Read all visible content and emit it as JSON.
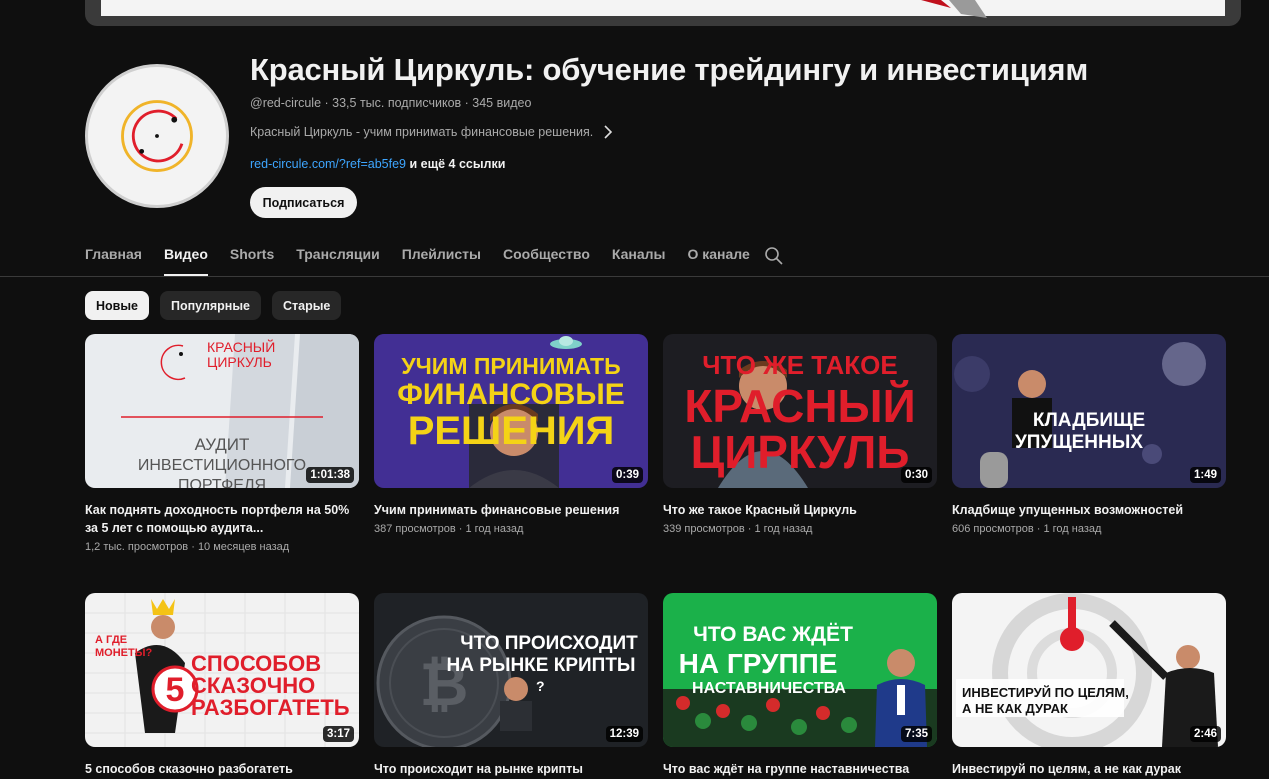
{
  "channel": {
    "title": "Красный Циркуль: обучение трейдингу и инвестициям",
    "handle": "@red-circule",
    "subscribers": "33,5 тыс. подписчиков",
    "video_count": "345 видео",
    "meta_separator": " · ",
    "description": "Красный Циркуль - учим принимать финансовые решения.",
    "link": "red-circule.com/?ref=ab5fe9",
    "more_links": " и ещё 4 ссылки",
    "subscribe_label": "Подписаться",
    "avatar_text": "О"
  },
  "tabs": [
    {
      "label": "Главная"
    },
    {
      "label": "Видео"
    },
    {
      "label": "Shorts"
    },
    {
      "label": "Трансляции"
    },
    {
      "label": "Плейлисты"
    },
    {
      "label": "Сообщество"
    },
    {
      "label": "Каналы"
    },
    {
      "label": "О канале"
    }
  ],
  "active_tab": "Видео",
  "chips": [
    {
      "label": "Новые"
    },
    {
      "label": "Популярные"
    },
    {
      "label": "Старые"
    }
  ],
  "active_chip": "Новые",
  "videos": [
    {
      "title": "Как поднять доходность портфеля на 50% за 5 лет с помощью аудита...",
      "views": "1,2 тыс. просмотров",
      "age": "10 месяцев назад",
      "duration": "1:01:38",
      "thumb": {
        "line1": "КРАСНЫЙ",
        "line2": "ЦИРКУЛЬ",
        "line3": "АУДИТ",
        "line4": "ИНВЕСТИЦИОННОГО",
        "line5": "ПОРТФЕЛЯ"
      }
    },
    {
      "title": "Учим принимать финансовые решения",
      "views": "387 просмотров",
      "age": "1 год назад",
      "duration": "0:39",
      "thumb": {
        "line1": "УЧИМ ПРИНИМАТЬ",
        "line2": "ФИНАНСОВЫЕ",
        "line3": "РЕШЕНИЯ"
      }
    },
    {
      "title": "Что же такое Красный Циркуль",
      "views": "339 просмотров",
      "age": "1 год назад",
      "duration": "0:30",
      "thumb": {
        "line1": "ЧТО ЖЕ ТАКОЕ",
        "line2": "КРАСНЫЙ",
        "line3": "ЦИРКУЛЬ"
      }
    },
    {
      "title": "Кладбище упущенных возможностей",
      "views": "606 просмотров",
      "age": "1 год назад",
      "duration": "1:49",
      "thumb": {
        "line1": "КЛАДБИЩЕ",
        "line2": "УПУЩЕННЫХ"
      }
    },
    {
      "title": "5 способов сказочно разбогатеть",
      "views": "",
      "age": "",
      "duration": "3:17",
      "thumb": {
        "line0": "А ГДЕ",
        "line0b": "МОНЕТЫ?",
        "line1": "5",
        "line2": "СПОСОБОВ",
        "line3": "СКАЗОЧНО",
        "line4": "РАЗБОГАТЕТЬ"
      }
    },
    {
      "title": "Что происходит на рынке крипты",
      "views": "",
      "age": "",
      "duration": "12:39",
      "thumb": {
        "line1": "ЧТО ПРОИСХОДИТ",
        "line2": "НА РЫНКЕ КРИПТЫ"
      }
    },
    {
      "title": "Что вас ждёт на группе наставничества",
      "views": "",
      "age": "",
      "duration": "7:35",
      "thumb": {
        "line1": "ЧТО ВАС ЖДЁТ",
        "line2": "НА ГРУППЕ",
        "line3": "НАСТАВНИЧЕСТВА"
      }
    },
    {
      "title": "Инвестируй по целям, а не как дурак",
      "views": "",
      "age": "",
      "duration": "2:46",
      "thumb": {
        "line1": "ИНВЕСТИРУЙ ПО ЦЕЛЯМ,",
        "line2": "А НЕ КАК ДУРАК"
      }
    }
  ],
  "colors": {
    "background": "#0f0f0f",
    "link": "#3ea6ff",
    "brand_red": "#e01e2b",
    "brand_yellow": "#f4d316",
    "green": "#1bb14a"
  }
}
